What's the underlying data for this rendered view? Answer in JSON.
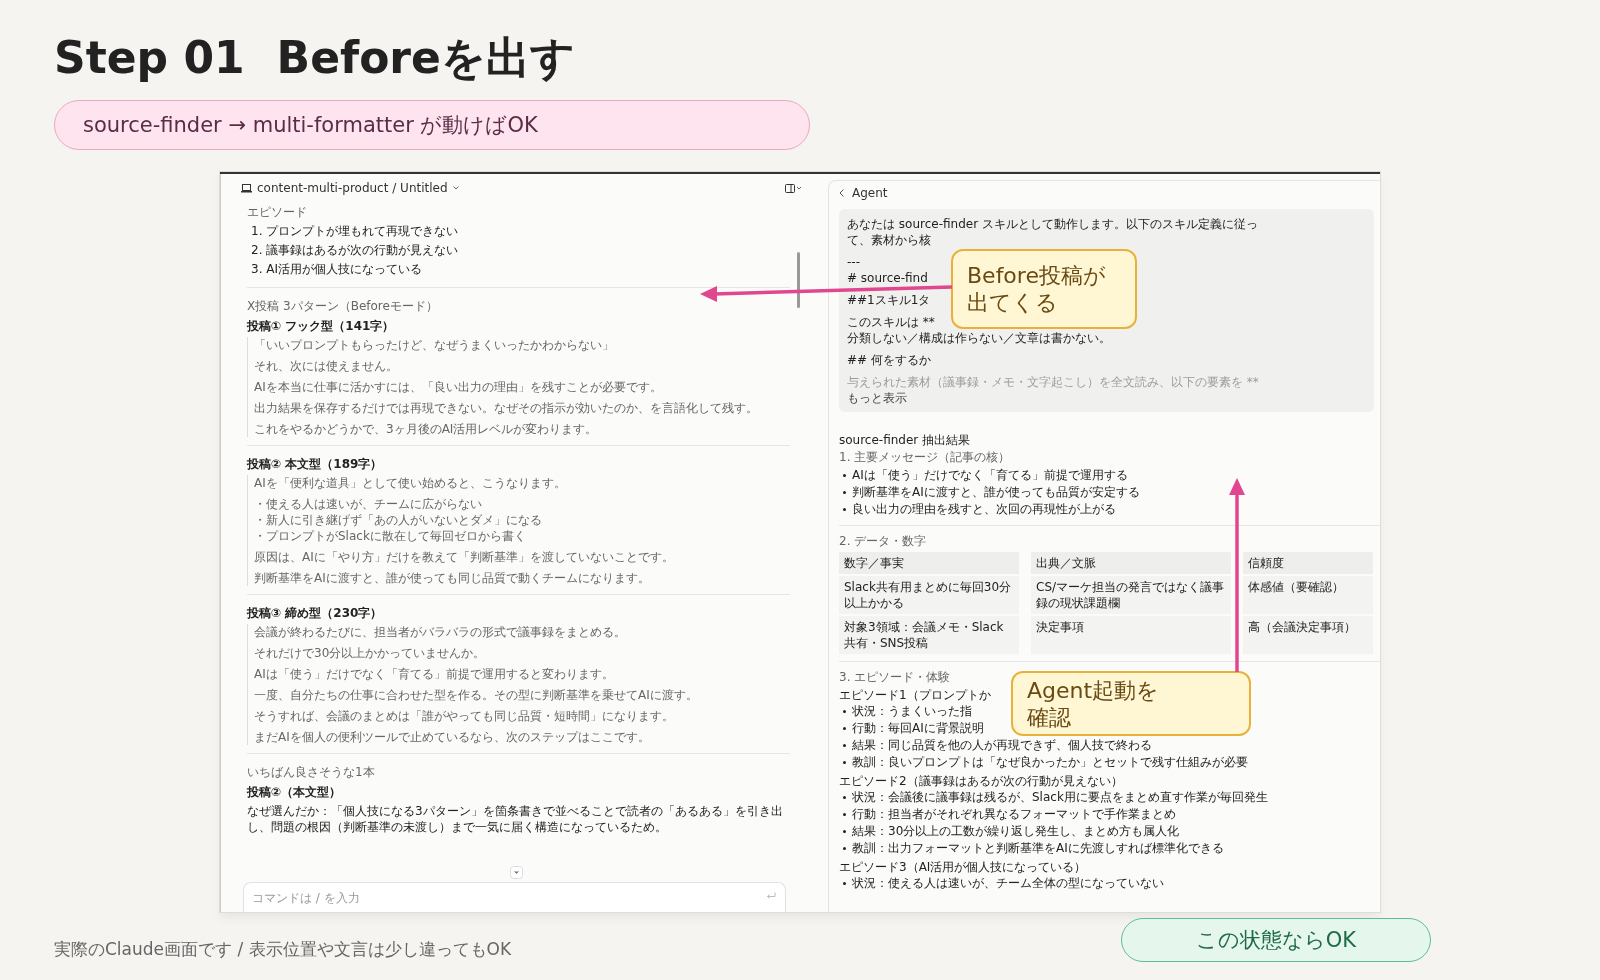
{
  "slide": {
    "step": "Step 01",
    "title": "Beforeを出す",
    "subtitle": "source-finder → multi-formatter が動けばOK"
  },
  "editor": {
    "breadcrumb": "content-multi-product / Untitled",
    "sections": [
      {
        "kind": "list",
        "divider": false,
        "label": "エピソード",
        "items": [
          "1. プロンプトが埋もれて再現できない",
          "2. 議事録はあるが次の行動が見えない",
          "3. AI活用が個人技になっている"
        ]
      },
      {
        "kind": "heading",
        "divider": true,
        "text": "X投稿 3パターン（Beforeモード）"
      },
      {
        "kind": "post",
        "divider": false,
        "title": "投稿① フック型（141字）",
        "paragraphs": [
          [
            "「いいプロンプトもらったけど、なぜうまくいったかわからない」"
          ],
          [
            "それ、次には使えません。"
          ],
          [
            "AIを本当に仕事に活かすには、「良い出力の理由」を残すことが必要です。"
          ],
          [
            "出力結果を保存するだけでは再現できない。なぜその指示が効いたのか、を言語化して残す。"
          ],
          [
            "これをやるかどうかで、3ヶ月後のAI活用レベルが変わります。"
          ]
        ]
      },
      {
        "kind": "post",
        "divider": true,
        "title": "投稿② 本文型（189字）",
        "paragraphs": [
          [
            "AIを「便利な道具」として使い始めると、こうなります。"
          ],
          [
            "・使える人は速いが、チームに広がらない",
            "・新人に引き継げず「あの人がいないとダメ」になる",
            "・プロンプトがSlackに散在して毎回ゼロから書く"
          ],
          [
            "原因は、AIに「やり方」だけを教えて「判断基準」を渡していないことです。"
          ],
          [
            "判断基準をAIに渡すと、誰が使っても同じ品質で動くチームになります。"
          ]
        ]
      },
      {
        "kind": "post",
        "divider": true,
        "title": "投稿③ 締め型（230字）",
        "paragraphs": [
          [
            "会議が終わるたびに、担当者がバラバラの形式で議事録をまとめる。"
          ],
          [
            "それだけで30分以上かかっていませんか。"
          ],
          [
            "AIは「使う」だけでなく「育てる」前提で運用すると変わります。"
          ],
          [
            "一度、自分たちの仕事に合わせた型を作る。その型に判断基準を乗せてAIに渡す。"
          ],
          [
            "そうすれば、会議のまとめは「誰がやっても同じ品質・短時間」になります。"
          ],
          [
            "まだAIを個人の便利ツールで止めているなら、次のステップはここです。"
          ]
        ]
      },
      {
        "kind": "best",
        "divider": true,
        "label": "いちばん良さそうな1本",
        "title": "投稿②（本文型）",
        "reason": "なぜ選んだか：「個人技になる3パターン」を箇条書きで並べることで読者の「あるある」を引き出し、問題の根因（判断基準の未渡し）まで一気に届く構造になっているため。"
      }
    ],
    "input": {
      "placeholder": "コマンドは / を入力"
    }
  },
  "agent": {
    "title": "Agent",
    "prompt_paragraphs": [
      [
        "あなたは source-finder スキルとして動作します。以下のスキル定義に従っ",
        "て、素材から核"
      ],
      [
        "---",
        "# source-find"
      ],
      [
        "##1スキル1タ"
      ],
      [
        "このスキルは **",
        "分類しない／構成は作らない／文章は書かない。"
      ],
      [
        "## 何をするか"
      ]
    ],
    "prompt_faded": "与えられた素材（議事録・メモ・文字起こし）を全文読み、以下の要素を **",
    "more": "もっと表示",
    "result_title": "source-finder 抽出結果",
    "sections": [
      {
        "kind": "bullets",
        "heading": "1. 主要メッセージ（記事の核）",
        "items": [
          "AIは「使う」だけでなく「育てる」前提で運用する",
          "判断基準をAIに渡すと、誰が使っても品質が安定する",
          "良い出力の理由を残すと、次回の再現性が上がる"
        ]
      },
      {
        "kind": "table",
        "heading": "2. データ・数字",
        "columns": [
          "数字／事実",
          "出典／文脈",
          "信頼度"
        ],
        "rows": [
          [
            "Slack共有用まとめに毎回30分以上かかる",
            "CS/マーケ担当の発言ではなく議事録の現状課題欄",
            "体感値（要確認）"
          ],
          [
            "対象3領域：会議メモ・Slack共有・SNS投稿",
            "決定事項",
            "高（会議決定事項）"
          ]
        ]
      },
      {
        "kind": "episodes",
        "heading": "3. エピソード・体験",
        "episodes": [
          {
            "title": "エピソード1（プロンプトか",
            "items": [
              "状況：うまくいった指",
              "行動：毎回AIに背景説明",
              "結果：同じ品質を他の人が再現できず、個人技で終わる",
              "教訓：良いプロンプトは「なぜ良かったか」とセットで残す仕組みが必要"
            ]
          },
          {
            "title": "エピソード2（議事録はあるが次の行動が見えない）",
            "items": [
              "状況：会議後に議事録は残るが、Slack用に要点をまとめ直す作業が毎回発生",
              "行動：担当者がそれぞれ異なるフォーマットで手作業まとめ",
              "結果：30分以上の工数が繰り返し発生し、まとめ方も属人化",
              "教訓：出力フォーマットと判断基準をAIに先渡しすれば標準化できる"
            ]
          },
          {
            "title": "エピソード3（AI活用が個人技になっている）",
            "items": [
              "状況：使える人は速いが、チーム全体の型になっていない"
            ]
          }
        ]
      }
    ]
  },
  "callouts": [
    {
      "lines": [
        "Before投稿が",
        "出てくる"
      ]
    },
    {
      "lines": [
        "Agent起動を",
        "確認"
      ]
    }
  ],
  "ok_badge": "この状態ならOK",
  "footnote": "実際のClaude画面です / 表示位置や文言は少し違ってもOK"
}
